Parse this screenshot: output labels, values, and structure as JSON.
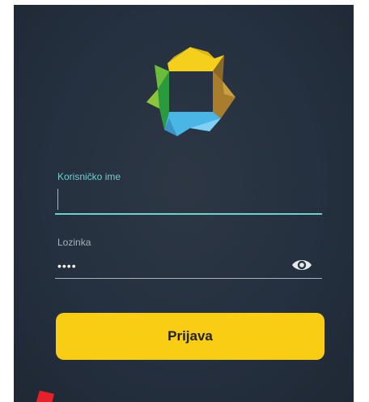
{
  "app": {
    "logo_icon": "kaleidoscope-star-logo",
    "colors": {
      "background": "#283240",
      "accent_teal": "#6cd1cd",
      "button_yellow": "#f8cd13",
      "logo_yellow": "#f4cf1c",
      "logo_green": "#2b9a3e",
      "logo_blue": "#49b6e6",
      "logo_brown": "#a87d2c"
    }
  },
  "form": {
    "username": {
      "label": "Korisničko ime",
      "value": ""
    },
    "password": {
      "label": "Lozinka",
      "value": "••••",
      "toggle_icon": "eye-icon"
    },
    "submit_label": "Prijava"
  }
}
